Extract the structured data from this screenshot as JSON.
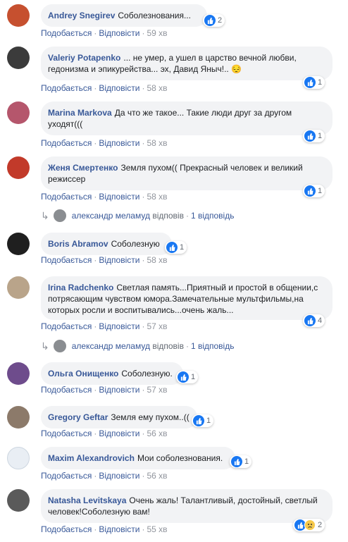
{
  "actions": {
    "like": "Подобається",
    "reply": "Відповісти",
    "sep": "·"
  },
  "comments": [
    {
      "name": "Andrey Snegirev",
      "text": "Соболезнования...",
      "time": "59 хв",
      "reactions": "2",
      "avatar_color": "#c6502f"
    },
    {
      "name": "Valeriy Potapenko",
      "text": "... не умер, а ушел в царство вечной любви, гедонизма и эпикурейства... эх, Давид Яныч!.. 😔",
      "time": "58 хв",
      "reactions": "1",
      "avatar_color": "#3b3b3b"
    },
    {
      "name": "Marina Markova",
      "text": "Да что же такое... Такие люди друг за другом уходят(((",
      "time": "58 хв",
      "reactions": "1",
      "avatar_color": "#b5566c"
    },
    {
      "name": "Женя Смертенко",
      "text": "Земля пухом(( Прекрасный человек и великий режиссер",
      "time": "58 хв",
      "reactions": "1",
      "avatar_color": "#c23a2a"
    },
    {
      "name": "Boris Abramov",
      "text": "Соболезную",
      "time": "58 хв",
      "reactions": "1",
      "avatar_color": "#1f1f1f"
    },
    {
      "name": "Irina Radchenko",
      "text": "Светлая память...Приятный и простой в общении,с потрясающим чувством юмора.Замечательные мультфильмы,на которых росли и воспитывались...очень жаль...",
      "time": "57 хв",
      "reactions": "4",
      "avatar_color": "#b9a48a"
    },
    {
      "name": "Ольга Онищенко",
      "text": "Соболезную.",
      "time": "57 хв",
      "reactions": "1",
      "avatar_color": "#6e4c8c"
    },
    {
      "name": "Gregory Geftar",
      "text": "Земля ему пухом..((",
      "time": "56 хв",
      "reactions": "1",
      "avatar_color": "#8c7a6a"
    },
    {
      "name": "Maxim Alexandrovich",
      "text": "Мои соболезнования.",
      "time": "56 хв",
      "reactions": "1",
      "avatar_color": "#e9eef4"
    },
    {
      "name": "Natasha Levitskaya",
      "text": "Очень жаль! Талантливый, достойный, светлый человек!Соболезную вам!",
      "time": "55 хв",
      "reactions": "2",
      "avatar_color": "#5a5a5a"
    }
  ],
  "reply_rows": [
    {
      "name": "александр меламуд",
      "verb": "відповів",
      "count": "1 відповідь"
    },
    {
      "name": "александр меламуд",
      "verb": "відповів",
      "count": "1 відповідь"
    }
  ],
  "colors": {
    "link": "#385898",
    "like": "#1877f2",
    "bubble": "#f2f3f5"
  }
}
